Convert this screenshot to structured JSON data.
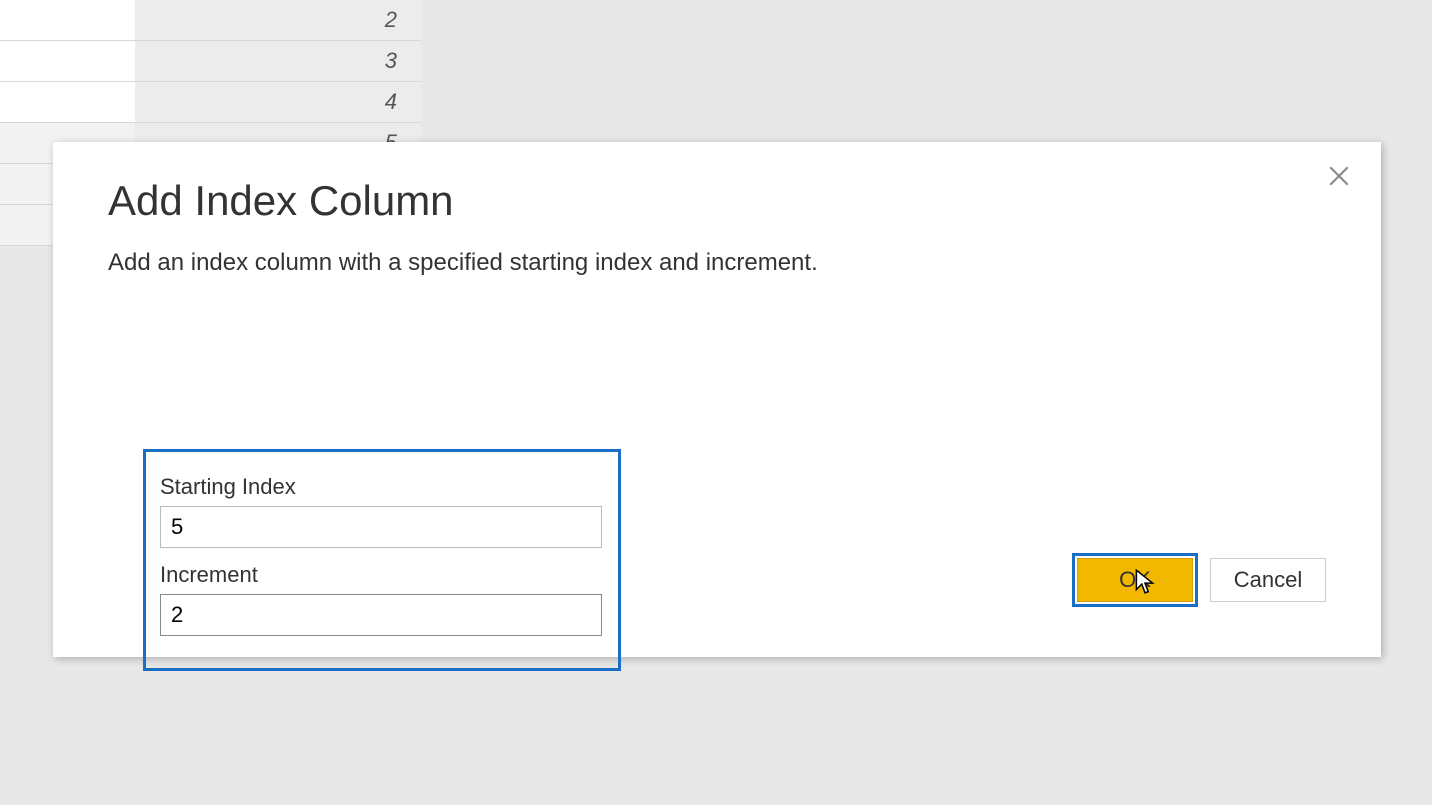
{
  "background": {
    "rows": [
      "2",
      "3",
      "4",
      "5",
      "",
      ""
    ]
  },
  "dialog": {
    "title": "Add Index Column",
    "description": "Add an index column with a specified starting index and increment.",
    "fields": {
      "starting_index": {
        "label": "Starting Index",
        "value": "5"
      },
      "increment": {
        "label": "Increment",
        "value": "2"
      }
    },
    "buttons": {
      "ok": "OK",
      "cancel": "Cancel"
    }
  }
}
